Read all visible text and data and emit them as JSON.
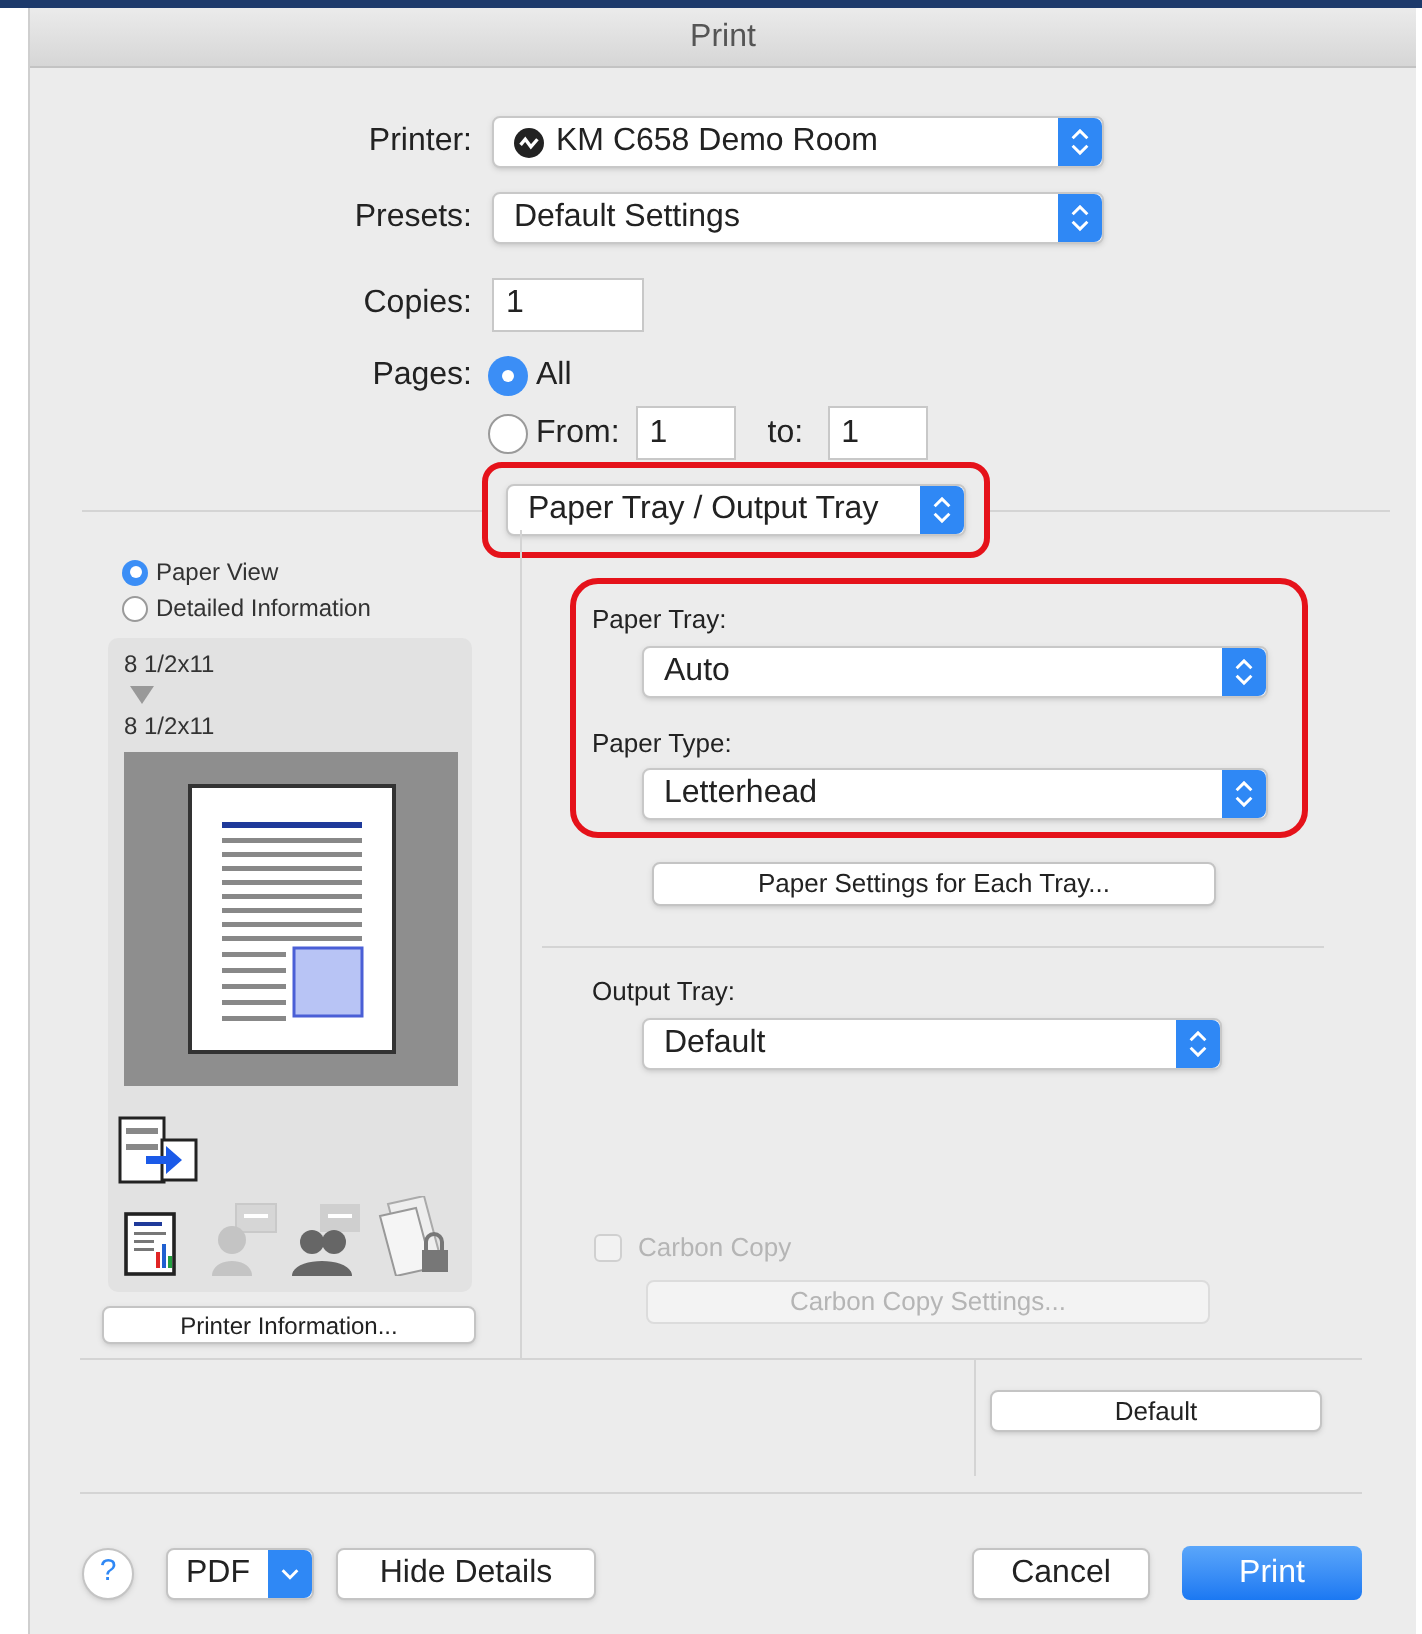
{
  "window": {
    "title": "Print"
  },
  "printer": {
    "label": "Printer:",
    "value": "KM C658 Demo Room"
  },
  "presets": {
    "label": "Presets:",
    "value": "Default Settings"
  },
  "copies": {
    "label": "Copies:",
    "value": "1"
  },
  "pages": {
    "label": "Pages:",
    "options": [
      {
        "label": "All",
        "selected": true
      },
      {
        "label": "From:",
        "selected": false
      }
    ],
    "from": "1",
    "to_label": "to:",
    "to": "1"
  },
  "panel_menu": {
    "value": "Paper Tray / Output Tray"
  },
  "preview": {
    "views": [
      {
        "label": "Paper View",
        "selected": true
      },
      {
        "label": "Detailed Information",
        "selected": false
      }
    ],
    "input_size": "8 1/2x11",
    "output_size": "8 1/2x11",
    "info_button": "Printer Information..."
  },
  "paper_tray": {
    "label": "Paper Tray:",
    "value": "Auto"
  },
  "paper_type": {
    "label": "Paper Type:",
    "value": "Letterhead"
  },
  "tray_settings_button": "Paper Settings for Each Tray...",
  "output_tray": {
    "label": "Output Tray:",
    "value": "Default"
  },
  "carbon_copy": {
    "label": "Carbon Copy",
    "checked": false,
    "disabled": true
  },
  "carbon_copy_settings": {
    "label": "Carbon Copy Settings...",
    "disabled": true
  },
  "default_button": "Default",
  "footer": {
    "help": "?",
    "pdf": "PDF",
    "hide_details": "Hide Details",
    "cancel": "Cancel",
    "print": "Print"
  }
}
